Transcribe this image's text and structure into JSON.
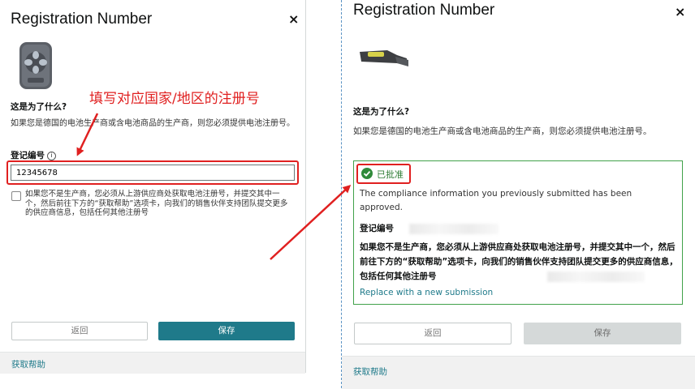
{
  "left": {
    "title": "Registration Number",
    "close": "×",
    "question": "这是为了什么?",
    "description": "如果您是德国的电池生产商或含电池商品的生产商，则您必须提供电池注册号。",
    "reg_label": "登记编号",
    "reg_value": "12345678",
    "checkbox_text": "如果您不是生产商，您必须从上游供应商处获取电池注册号，并提交其中一个，然后前往下方的“获取帮助”选项卡，向我们的销售伙伴支持团队提交更多的供应商信息，包括任何其他注册号",
    "back_label": "返回",
    "save_label": "保存",
    "help_label": "获取帮助"
  },
  "annotation": "填写对应国家/地区的注册号",
  "right": {
    "title": "Registration Number",
    "close": "×",
    "question": "这是为了什么?",
    "description": "如果您是德国的电池生产商或含电池商品的生产商，则您必须提供电池注册号。",
    "status_label": "已批准",
    "status_message": "The compliance information you previously submitted has been approved.",
    "reg_label": "登记编号",
    "note": "如果您不是生产商，您必须从上游供应商处获取电池注册号，并提交其中一个，然后前往下方的“获取帮助”选项卡，向我们的销售伙伴支持团队提交更多的供应商信息，包括任何其他注册号",
    "replace_link": "Replace with a new submission",
    "back_label": "返回",
    "save_label": "保存",
    "help_label": "获取帮助"
  },
  "colors": {
    "accent": "#1f7a8a",
    "approved": "#41a24a",
    "annotation": "#e02020"
  },
  "icons": {
    "close": "close-icon",
    "info": "info-icon",
    "approved": "check-circle-icon"
  }
}
